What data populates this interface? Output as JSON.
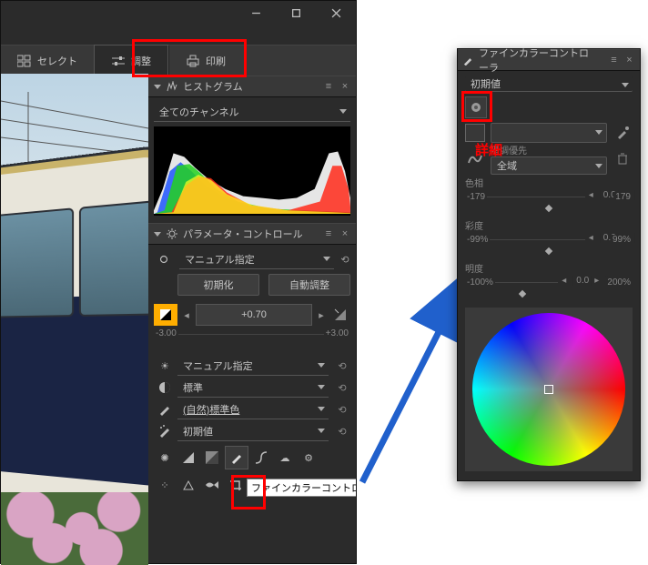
{
  "window_controls": {
    "min": "minimize",
    "max": "maximize",
    "close": "close"
  },
  "tabs": {
    "select": {
      "label": "セレクト"
    },
    "adjust": {
      "label": "調整"
    },
    "print": {
      "label": "印刷"
    }
  },
  "histogram": {
    "title": "ヒストグラム",
    "channel_dd": "全てのチャンネル"
  },
  "param_ctrl": {
    "title": "パラメータ・コントロール",
    "mode_dd": "マニュアル指定",
    "reset_btn": "初期化",
    "auto_btn": "自動調整",
    "ev_value": "+0.70",
    "ev_min": "-3.00",
    "ev_max": "+3.00",
    "wb_dd": "マニュアル指定",
    "tone_dd": "標準",
    "color_dd": "(自然)標準色",
    "nr_dd": "初期値"
  },
  "fcc": {
    "tooltip": "ファインカラーコントローラ",
    "title": "ファインカラーコントローラ",
    "preset_dd": "初期値",
    "annot": "詳細",
    "scope_label": "階調優先",
    "scope_dd": "全域",
    "hue": {
      "label": "色相",
      "min": "-179",
      "val": "0.0",
      "max": "179"
    },
    "sat": {
      "label": "彩度",
      "min": "-99%",
      "val": "0.0",
      "max": "99%"
    },
    "lum": {
      "label": "明度",
      "min": "-100%",
      "val": "0.0",
      "max": "200%"
    }
  }
}
